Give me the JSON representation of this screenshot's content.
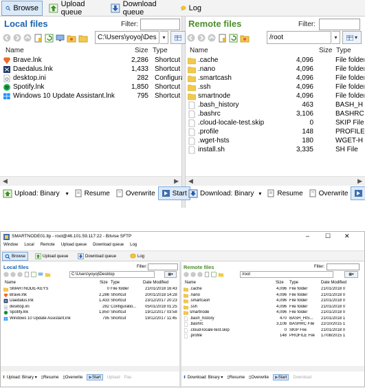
{
  "toolbar": {
    "browse": "Browse",
    "upload_queue": "Upload queue",
    "download_queue": "Download queue",
    "log": "Log"
  },
  "local": {
    "title": "Local files",
    "filter_label": "Filter:",
    "path": "C:\\Users\\yoyoj\\Des",
    "columns": {
      "name": "Name",
      "size": "Size",
      "type": "Type"
    },
    "files": [
      {
        "name": "Brave.lnk",
        "size": "2,286",
        "type": "Shortcut",
        "icon": "brave-icon"
      },
      {
        "name": "Daedalus.lnk",
        "size": "1,433",
        "type": "Shortcut",
        "icon": "daedalus-icon"
      },
      {
        "name": "desktop.ini",
        "size": "282",
        "type": "Configuratic",
        "icon": "settings-file-icon"
      },
      {
        "name": "Spotify.lnk",
        "size": "1,850",
        "type": "Shortcut",
        "icon": "spotify-icon"
      },
      {
        "name": "Windows 10 Update Assistant.lnk",
        "size": "795",
        "type": "Shortcut",
        "icon": "windows-icon"
      }
    ]
  },
  "remote": {
    "title": "Remote files",
    "filter_label": "Filter:",
    "path": "/root",
    "columns": {
      "name": "Name",
      "size": "Size",
      "type": "Type"
    },
    "files": [
      {
        "name": ".cache",
        "size": "4,096",
        "type": "File folder",
        "icon": "folder-icon"
      },
      {
        "name": ".nano",
        "size": "4,096",
        "type": "File folder",
        "icon": "folder-icon"
      },
      {
        "name": ".smartcash",
        "size": "4,096",
        "type": "File folder",
        "icon": "folder-icon"
      },
      {
        "name": ".ssh",
        "size": "4,096",
        "type": "File folder",
        "icon": "folder-icon"
      },
      {
        "name": "smartnode",
        "size": "4,096",
        "type": "File folder",
        "icon": "folder-icon"
      },
      {
        "name": ".bash_history",
        "size": "463",
        "type": "BASH_H",
        "icon": "file-icon"
      },
      {
        "name": ".bashrc",
        "size": "3,106",
        "type": "BASHRC",
        "icon": "file-icon"
      },
      {
        "name": ".cloud-locale-test.skip",
        "size": "0",
        "type": "SKIP File",
        "icon": "file-icon"
      },
      {
        "name": ".profile",
        "size": "148",
        "type": "PROFILE",
        "icon": "file-icon"
      },
      {
        "name": ".wget-hsts",
        "size": "180",
        "type": "WGET-H",
        "icon": "file-icon"
      },
      {
        "name": "install.sh",
        "size": "3,335",
        "type": "SH File",
        "icon": "file-icon"
      }
    ]
  },
  "bottom_left": {
    "upload_mode": "Upload: Binary",
    "resume": "Resume",
    "overwrite": "Overwrite",
    "start": "Start"
  },
  "bottom_right": {
    "download_mode": "Download: Binary",
    "resume": "Resume",
    "overwrite": "Overwrite",
    "start": "S"
  },
  "window": {
    "title": "SMARTNODE01.tlp - root@46.101.59.117:22 - Bitvise SFTP",
    "menu": [
      "Window",
      "Local",
      "Remote",
      "Upload queue",
      "Download queue",
      "Log"
    ],
    "toolbar": {
      "browse": "Browse",
      "upload_queue": "Upload queue",
      "download_queue": "Download queue",
      "log": "Log"
    },
    "local": {
      "title": "Local files",
      "filter_label": "Filter:",
      "path": "C:\\Users\\yoyoj\\Desktop",
      "columns": {
        "name": "Name",
        "size": "Size",
        "type": "Type",
        "date": "Date Modified"
      },
      "files": [
        {
          "name": "SMARTNODE-KEYS",
          "size": "0",
          "type": "File folder",
          "date": "21/01/2018 16:43",
          "icon": "folder-icon"
        },
        {
          "name": "Brave.lnk",
          "size": "2,286",
          "type": "Shortcut",
          "date": "20/01/2018 14:28",
          "icon": "brave-icon"
        },
        {
          "name": "Daedalus.lnk",
          "size": "1,433",
          "type": "Shortcut",
          "date": "23/12/2017 20:23",
          "icon": "daedalus-icon"
        },
        {
          "name": "desktop.ini",
          "size": "282",
          "type": "Configuratio...",
          "date": "05/01/2018 01:25",
          "icon": "settings-file-icon"
        },
        {
          "name": "Spotify.lnk",
          "size": "1,850",
          "type": "Shortcut",
          "date": "19/12/2017 03:58",
          "icon": "spotify-icon"
        },
        {
          "name": "Windows 10 Update Assistant.lnk",
          "size": "795",
          "type": "Shortcut",
          "date": "19/12/2017 11:45",
          "icon": "windows-icon"
        }
      ]
    },
    "remote": {
      "title": "Remote files",
      "filter_label": "Filter:",
      "path": "/root",
      "columns": {
        "name": "Name",
        "size": "Size",
        "type": "Type",
        "date": "Date Modified"
      },
      "files": [
        {
          "name": ".cache",
          "size": "4,096",
          "type": "File folder",
          "date": "21/01/2018 0",
          "icon": "folder-icon"
        },
        {
          "name": ".nano",
          "size": "4,096",
          "type": "File folder",
          "date": "21/01/2018 0",
          "icon": "folder-icon"
        },
        {
          "name": ".smartcash",
          "size": "4,096",
          "type": "File folder",
          "date": "21/01/2018 0",
          "icon": "folder-icon"
        },
        {
          "name": ".ssh",
          "size": "4,096",
          "type": "File folder",
          "date": "21/01/2018 0",
          "icon": "folder-icon"
        },
        {
          "name": "smartnode",
          "size": "4,096",
          "type": "File folder",
          "date": "21/01/2018 0",
          "icon": "folder-icon"
        },
        {
          "name": ".bash_history",
          "size": "470",
          "type": "BASH_HIS...",
          "date": "21/01/2018 1",
          "icon": "file-icon"
        },
        {
          "name": ".bashrc",
          "size": "3,106",
          "type": "BASHRC File",
          "date": "22/10/2015 1",
          "icon": "file-icon"
        },
        {
          "name": ".cloud-locale-test.skip",
          "size": "0",
          "type": "SKIP File",
          "date": "21/01/2018 0",
          "icon": "file-icon"
        },
        {
          "name": ".profile",
          "size": "148",
          "type": "PROFILE File",
          "date": "17/08/2015 1",
          "icon": "file-icon"
        }
      ]
    },
    "bottom_left": {
      "upload_mode": "Upload: Binary",
      "resume": "Resume",
      "overwrite": "Overwrite",
      "start": "Start",
      "upload": "Upload",
      "pause": "Pau"
    },
    "bottom_right": {
      "download_mode": "Download: Binary",
      "resume": "Resume",
      "overwrite": "Overwrite",
      "start": "Start",
      "download": "Download"
    }
  },
  "colors": {
    "accent_blue": "#1c63b0",
    "selection_bg": "#dbe9f8",
    "folder_yellow": "#f2c94c",
    "title_green": "#4a8d2a"
  }
}
